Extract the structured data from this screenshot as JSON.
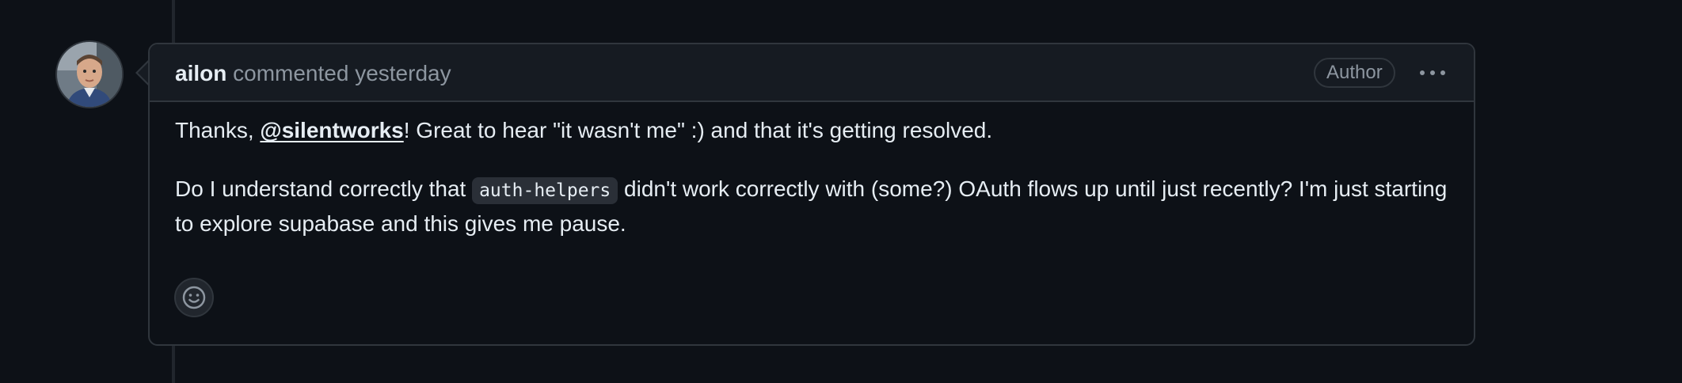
{
  "comment": {
    "author": "ailon",
    "action": "commented",
    "time": "yesterday",
    "badge": "Author",
    "body": {
      "p1_prefix": "Thanks, ",
      "p1_mention": "@silentworks",
      "p1_suffix": "! Great to hear \"it wasn't me\" :) and that it's getting resolved.",
      "p2_prefix": "Do I understand correctly that ",
      "p2_code": "auth-helpers",
      "p2_suffix": " didn't work correctly with (some?) OAuth flows up until just recently? I'm just starting to explore supabase and this gives me pause."
    }
  },
  "icons": {
    "more": "kebab-horizontal-icon",
    "reaction": "smiley-icon",
    "avatar": "user-avatar"
  },
  "colors": {
    "background": "#0d1117",
    "header_background": "#161b22",
    "border": "#30363d",
    "muted_text": "#8d96a0",
    "text": "#e6edf3",
    "code_background": "#2a2f37"
  }
}
